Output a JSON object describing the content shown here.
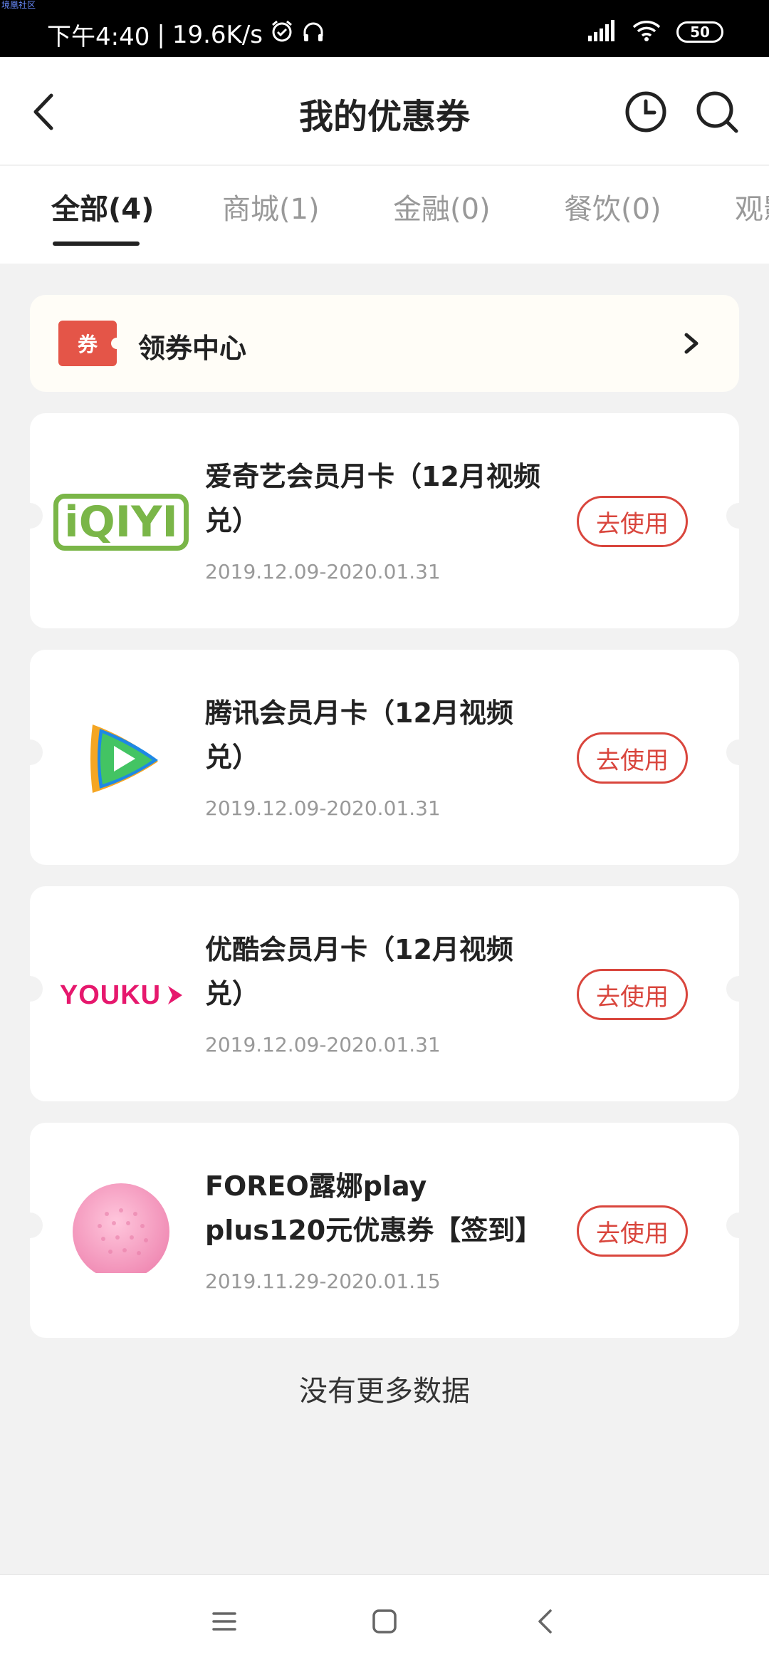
{
  "status_bar": {
    "watermark": "境凰社区",
    "time": "下午4:40",
    "speed": "19.6K/s",
    "battery": "50",
    "icons": [
      "alarm-icon",
      "headset-icon",
      "signal-icon",
      "wifi-icon",
      "battery-icon"
    ]
  },
  "header": {
    "title": "我的优惠券",
    "icons": [
      "back-arrow-icon",
      "history-clock-icon",
      "search-icon"
    ]
  },
  "tabs": [
    {
      "label": "全部(4)",
      "active": true
    },
    {
      "label": "商城(1)",
      "active": false
    },
    {
      "label": "金融(0)",
      "active": false
    },
    {
      "label": "餐饮(0)",
      "active": false
    },
    {
      "label": "观影",
      "active": false
    }
  ],
  "coupon_center": {
    "badge": "券",
    "label": "领券中心",
    "icon": "chevron-right-icon"
  },
  "coupons": [
    {
      "brand": "iQIYI",
      "logo_text": "iQIYI",
      "title": "爱奇艺会员月卡（12月视频兑）",
      "date": "2019.12.09-2020.01.31",
      "action": "去使用"
    },
    {
      "brand": "Tencent Video",
      "title": "腾讯会员月卡（12月视频兑）",
      "date": "2019.12.09-2020.01.31",
      "action": "去使用"
    },
    {
      "brand": "Youku",
      "logo_text": "YOUKU",
      "title": "优酷会员月卡（12月视频兑）",
      "date": "2019.12.09-2020.01.31",
      "action": "去使用"
    },
    {
      "brand": "FOREO",
      "title": "FOREO露娜play plus120元优惠券【签到】",
      "date": "2019.11.29-2020.01.15",
      "action": "去使用"
    }
  ],
  "footer": {
    "no_more": "没有更多数据"
  },
  "colors": {
    "accent": "#d9463d",
    "badge": "#e45548",
    "background": "#f2f2f2"
  }
}
